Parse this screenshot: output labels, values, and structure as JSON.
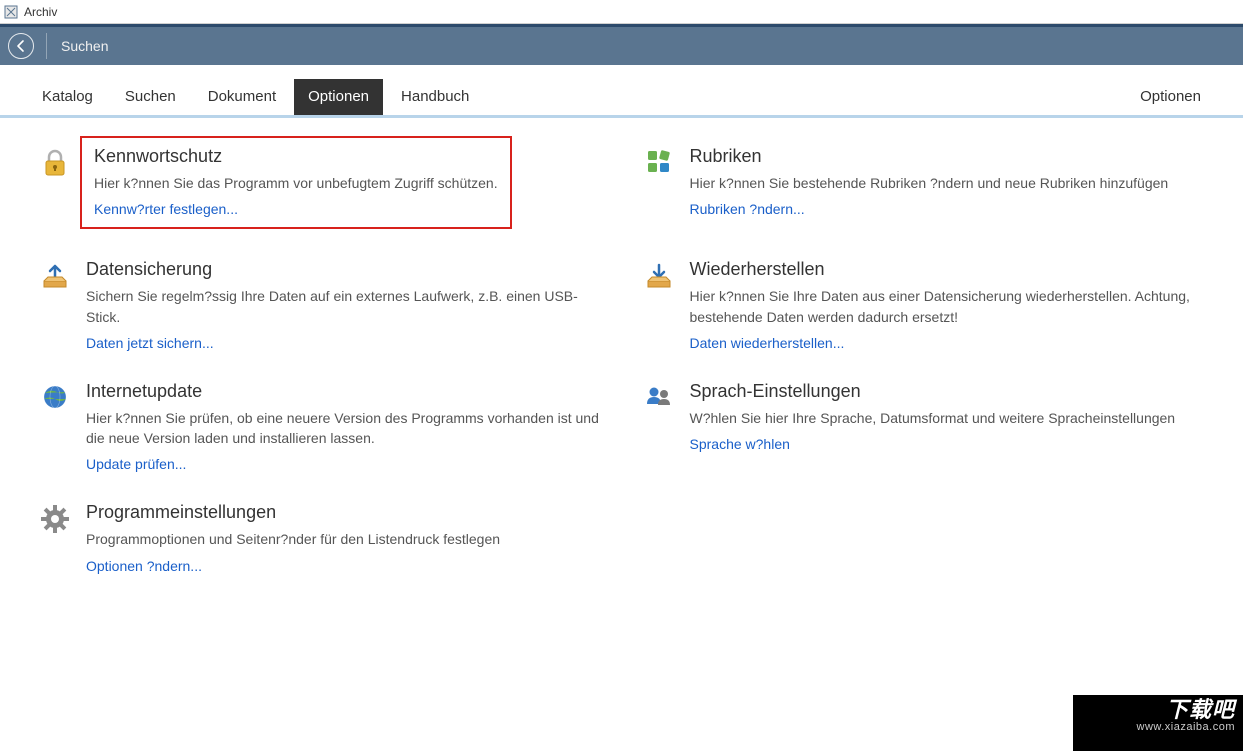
{
  "window": {
    "title": "Archiv"
  },
  "toolbar": {
    "label": "Suchen"
  },
  "tabs": {
    "items": [
      {
        "label": "Katalog"
      },
      {
        "label": "Suchen"
      },
      {
        "label": "Dokument"
      },
      {
        "label": "Optionen"
      },
      {
        "label": "Handbuch"
      }
    ],
    "activeIndex": 3,
    "right": "Optionen"
  },
  "cards": {
    "password": {
      "title": "Kennwortschutz",
      "desc": "Hier k?nnen Sie das Programm vor unbefugtem Zugriff schützen.",
      "link": "Kennw?rter festlegen..."
    },
    "categories": {
      "title": "Rubriken",
      "desc": "Hier k?nnen Sie bestehende Rubriken ?ndern und neue Rubriken hinzufügen",
      "link": "Rubriken ?ndern..."
    },
    "backup": {
      "title": "Datensicherung",
      "desc": "Sichern Sie regelm?ssig Ihre Daten auf ein externes Laufwerk, z.B. einen USB-Stick.",
      "link": "Daten jetzt sichern..."
    },
    "restore": {
      "title": "Wiederherstellen",
      "desc": "Hier k?nnen Sie Ihre Daten aus einer Datensicherung wiederherstellen. Achtung, bestehende Daten werden dadurch ersetzt!",
      "link": "Daten wiederherstellen..."
    },
    "update": {
      "title": "Internetupdate",
      "desc": "Hier k?nnen Sie prüfen, ob eine neuere Version des Programms vorhanden ist und die neue Version laden und installieren lassen.",
      "link": "Update prüfen..."
    },
    "language": {
      "title": "Sprach-Einstellungen",
      "desc": "W?hlen Sie hier Ihre Sprache, Datumsformat und weitere Spracheinstellungen",
      "link": "Sprache w?hlen"
    },
    "program": {
      "title": "Programmeinstellungen",
      "desc": "Programmoptionen und Seitenr?nder für den Listendruck festlegen",
      "link": "Optionen ?ndern..."
    }
  },
  "watermark": {
    "big": "下载吧",
    "small": "www.xiazaiba.com"
  }
}
